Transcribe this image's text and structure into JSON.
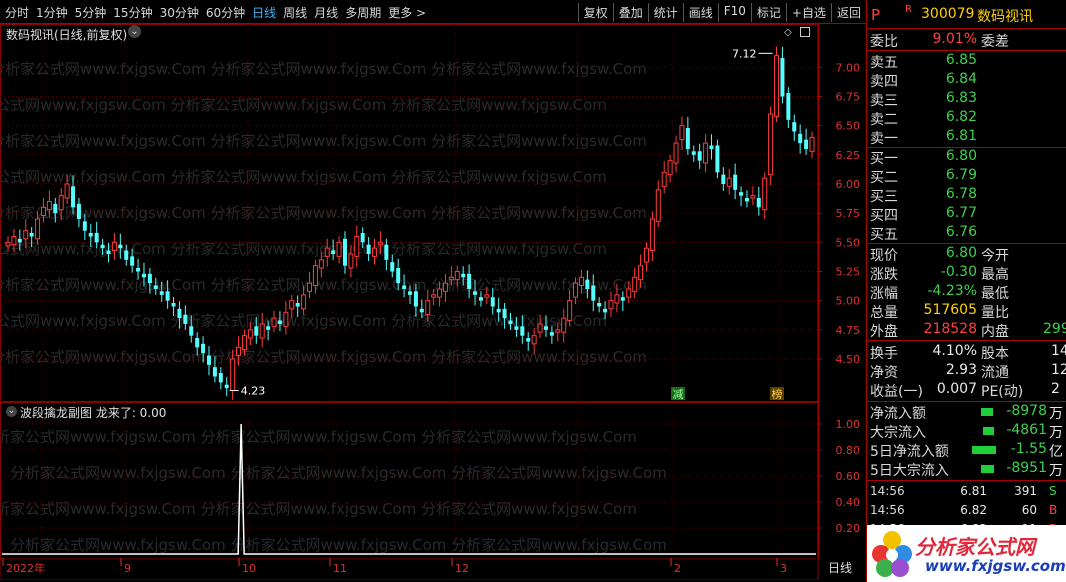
{
  "toolbar": {
    "periods": [
      "分时",
      "1分钟",
      "5分钟",
      "15分钟",
      "30分钟",
      "60分钟",
      "日线",
      "周线",
      "月线",
      "多周期",
      "更多 >"
    ],
    "active_period": "日线",
    "buttons": [
      "复权",
      "叠加",
      "统计",
      "画线",
      "F10",
      "标记",
      "+自选",
      "返回"
    ]
  },
  "main_chart": {
    "title": "数码视讯(日线,前复权)",
    "high_label": "7.12",
    "low_label": "4.23",
    "marker_jian": "减",
    "marker_bang": "榜",
    "y_ticks": [
      "7.00",
      "6.75",
      "6.50",
      "6.25",
      "6.00",
      "5.75",
      "5.50",
      "5.25",
      "5.00",
      "4.75",
      "4.50"
    ],
    "watermark": "分析家公式网www.fxjgsw.Com"
  },
  "sub_chart": {
    "title": "波段擒龙副图 龙来了: 0.00",
    "y_ticks": [
      "1.00",
      "0.80",
      "0.60",
      "0.40",
      "0.20"
    ]
  },
  "date_axis": {
    "labels": [
      "2022年",
      "9",
      "10",
      "11",
      "12",
      "2",
      "3"
    ],
    "period_label": "日线"
  },
  "chart_data": {
    "type": "candlestick",
    "ylim": [
      4.2,
      7.2
    ],
    "y_ticks": [
      7.0,
      6.75,
      6.5,
      6.25,
      6.0,
      5.75,
      5.5,
      5.25,
      5.0,
      4.75,
      4.5
    ],
    "high_annotation": 7.12,
    "low_annotation": 4.23,
    "close_series": [
      5.5,
      5.55,
      5.5,
      5.6,
      5.55,
      5.7,
      5.8,
      5.85,
      5.75,
      5.9,
      6.0,
      5.8,
      5.7,
      5.6,
      5.55,
      5.5,
      5.45,
      5.4,
      5.5,
      5.45,
      5.35,
      5.3,
      5.25,
      5.2,
      5.15,
      5.1,
      5.05,
      5.0,
      4.95,
      4.85,
      4.8,
      4.7,
      4.6,
      4.55,
      4.45,
      4.35,
      4.3,
      4.25,
      4.5,
      4.6,
      4.7,
      4.75,
      4.7,
      4.8,
      4.75,
      4.85,
      4.8,
      4.9,
      5.0,
      4.95,
      5.05,
      5.15,
      5.3,
      5.35,
      5.45,
      5.4,
      5.5,
      5.3,
      5.4,
      5.55,
      5.5,
      5.4,
      5.45,
      5.5,
      5.35,
      5.25,
      5.15,
      5.1,
      5.05,
      4.95,
      4.9,
      5.0,
      5.05,
      5.1,
      5.15,
      5.2,
      5.25,
      5.2,
      5.1,
      5.05,
      5.0,
      5.05,
      4.95,
      4.9,
      4.85,
      4.8,
      4.75,
      4.7,
      4.65,
      4.7,
      4.8,
      4.75,
      4.7,
      4.75,
      4.85,
      5.0,
      5.15,
      5.2,
      5.1,
      5.0,
      4.95,
      4.9,
      5.0,
      5.05,
      5.0,
      5.1,
      5.2,
      5.3,
      5.45,
      5.7,
      5.95,
      6.1,
      6.2,
      6.35,
      6.5,
      6.3,
      6.25,
      6.2,
      6.35,
      6.3,
      6.1,
      6.0,
      6.05,
      5.95,
      5.9,
      5.85,
      5.9,
      5.8,
      6.05,
      6.6,
      7.1,
      6.75,
      6.55,
      6.45,
      6.35,
      6.3,
      6.4
    ]
  },
  "sub_chart_data": {
    "type": "line",
    "spike_value": 1.0,
    "spike_position": 0.29
  },
  "panel": {
    "code": "300079",
    "name": "数码视讯",
    "p_label": "P",
    "r_label": "R",
    "weibi_label": "委比",
    "weibi_value": "9.01%",
    "weicha_label": "委差",
    "sells": [
      {
        "label": "卖五",
        "price": "6.85"
      },
      {
        "label": "卖四",
        "price": "6.84"
      },
      {
        "label": "卖三",
        "price": "6.83"
      },
      {
        "label": "卖二",
        "price": "6.82"
      },
      {
        "label": "卖一",
        "price": "6.81"
      }
    ],
    "buys": [
      {
        "label": "买一",
        "price": "6.80"
      },
      {
        "label": "买二",
        "price": "6.79"
      },
      {
        "label": "买三",
        "price": "6.78"
      },
      {
        "label": "买四",
        "price": "6.77"
      },
      {
        "label": "买五",
        "price": "6.76"
      }
    ],
    "quote": [
      {
        "l1": "现价",
        "v1": "6.80",
        "l2": "今开"
      },
      {
        "l1": "涨跌",
        "v1": "-0.30",
        "l2": "最高"
      },
      {
        "l1": "涨幅",
        "v1": "-4.23%",
        "l2": "最低"
      },
      {
        "l1": "总量",
        "v1": "517605",
        "l2": "量比"
      },
      {
        "l1": "外盘",
        "v1": "218528",
        "l2": "内盘",
        "v2": "299"
      }
    ],
    "fundamentals": [
      {
        "l1": "换手",
        "v1": "4.10%",
        "l2": "股本",
        "v2": "14"
      },
      {
        "l1": "净资",
        "v1": "2.93",
        "l2": "流通",
        "v2": "12"
      },
      {
        "l1": "收益(一)",
        "v1": "0.007",
        "l2": "PE(动)",
        "v2": "2"
      }
    ],
    "flows": [
      {
        "label": "净流入额",
        "value": "-8978",
        "unit": "万",
        "bar": 0.12
      },
      {
        "label": "大宗流入",
        "value": "-4861",
        "unit": "万",
        "bar": 0.07
      },
      {
        "label": "5日净流入额",
        "value": "-1.55",
        "unit": "亿",
        "bar": 0.45
      },
      {
        "label": "5日大宗流入",
        "value": "-8951",
        "unit": "万",
        "bar": 0.13
      }
    ],
    "ticks": [
      {
        "time": "14:56",
        "price": "6.81",
        "vol": "391",
        "side": "S"
      },
      {
        "time": "14:56",
        "price": "6.82",
        "vol": "60",
        "side": "B"
      },
      {
        "time": "14:56",
        "price": "6.82",
        "vol": "11",
        "side": "B"
      }
    ]
  },
  "logo": {
    "text": "分析家公式网",
    "url": "www.fxjgsw.com"
  }
}
